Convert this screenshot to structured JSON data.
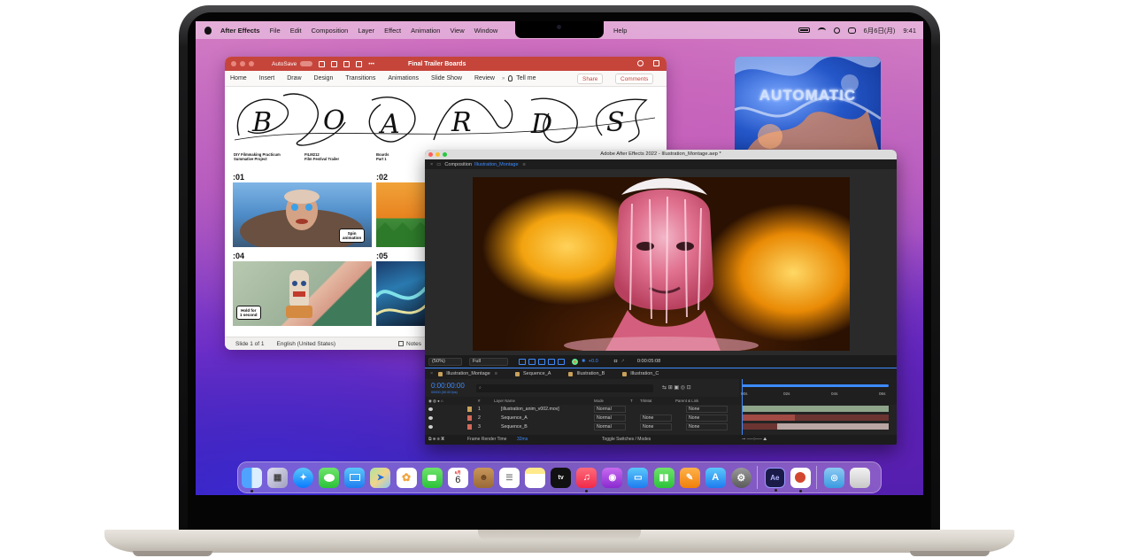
{
  "menubar": {
    "app_name": "After Effects",
    "items": [
      "File",
      "Edit",
      "Composition",
      "Layer",
      "Effect",
      "Animation",
      "View",
      "Window",
      "Help"
    ],
    "date": "6月6日(月)",
    "time": "9:41"
  },
  "powerpoint": {
    "autosave_label": "AutoSave",
    "autosave_state": "OFF",
    "document_title": "Final Trailer Boards",
    "ribbon_tabs": [
      "Home",
      "Insert",
      "Draw",
      "Design",
      "Transitions",
      "Animations",
      "Slide Show",
      "Review"
    ],
    "tell_me": "Tell me",
    "share_label": "Share",
    "comments_label": "Comments",
    "slide": {
      "title_letters": [
        "B",
        "O",
        "A",
        "R",
        "D",
        "S"
      ],
      "meta": [
        {
          "line1": "DIY Filmmaking Practicum",
          "line2": "Summative Project"
        },
        {
          "line1": "FILM212",
          "line2": "Film Festival Trailer"
        },
        {
          "line1": "Boards",
          "line2": "Part 1"
        }
      ],
      "panels": [
        {
          "number": ":01",
          "note_line1": "Spin",
          "note_line2": "animation"
        },
        {
          "number": ":02"
        },
        {
          "number": ":04",
          "note_line1": "Hold for",
          "note_line2": "1 second"
        },
        {
          "number": ":05"
        }
      ]
    },
    "status": {
      "slide_indicator": "Slide 1 of 1",
      "language": "English (United States)",
      "notes_label": "Notes"
    }
  },
  "album": {
    "title": "AUTOMATIC"
  },
  "after_effects": {
    "window_title": "Adobe After Effects 2022 - Illustration_Montage.aep *",
    "composition_label": "Composition",
    "composition_name": "Illustration_Montage",
    "viewer": {
      "zoom": "(50%)",
      "resolution": "Full",
      "exposure": "+0.0",
      "timecode": "0:00:05:08"
    },
    "timeline_tabs": [
      {
        "name": "Illustration_Montage",
        "color": "#c9a15a"
      },
      {
        "name": "Sequence_A",
        "color": "#c9a15a"
      },
      {
        "name": "Illustration_B",
        "color": "#c9a15a"
      },
      {
        "name": "Illustration_C",
        "color": "#c9a15a"
      }
    ],
    "current_time": "0:00:00:00",
    "fps": "00000 (30.00 fps)",
    "columns": {
      "layer_name": "Layer Name",
      "mode": "Mode",
      "t": "T",
      "trkmat": "TrkMat",
      "parent": "Parent & Link"
    },
    "layers": [
      {
        "index": "1",
        "name": "[illustration_anim_v002.mov]",
        "mode": "Normal",
        "trkmat": "",
        "parent": "None",
        "label_color": "#c9a15a"
      },
      {
        "index": "2",
        "name": "Sequence_A",
        "mode": "Normal",
        "trkmat": "None",
        "parent": "None",
        "label_color": "#d36a5a"
      },
      {
        "index": "3",
        "name": "Sequence_B",
        "mode": "Normal",
        "trkmat": "None",
        "parent": "None",
        "label_color": "#d36a5a"
      }
    ],
    "ruler_ticks": [
      "00s",
      "02s",
      "04s",
      "06s"
    ],
    "footer": {
      "render_label": "Frame Render Time",
      "render_value": "32ms",
      "toggle_label": "Toggle Switches / Modes"
    }
  },
  "dock": {
    "calendar_day": "6",
    "calendar_month": "6月",
    "ae_label": "Ae",
    "tv_label": "tv"
  }
}
